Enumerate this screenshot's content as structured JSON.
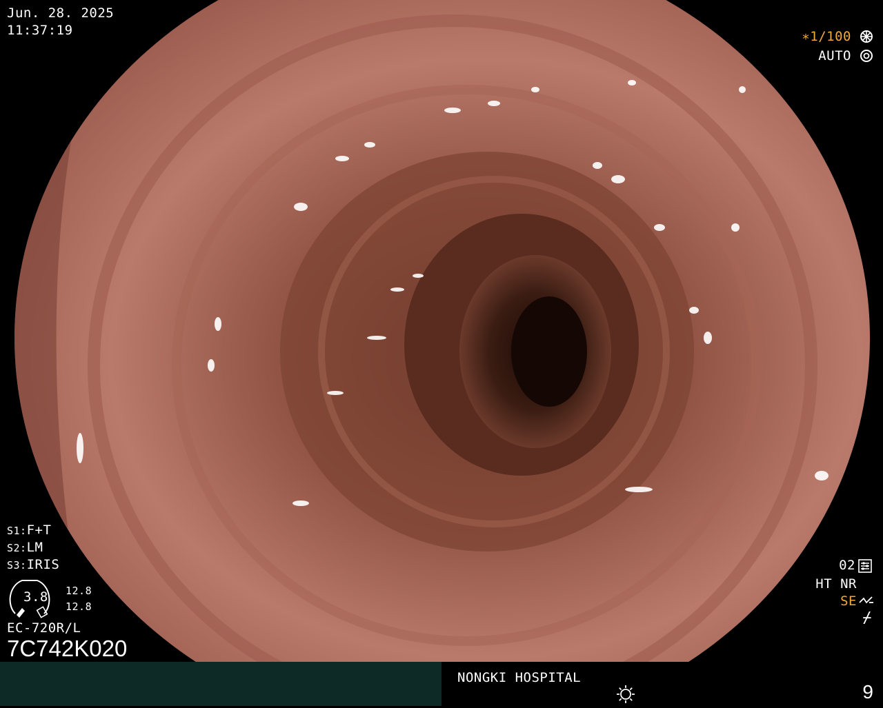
{
  "overlay": {
    "date": "Jun. 28. 2025",
    "time": "11:37:19",
    "shutter": "∗1/100",
    "exposure_mode": "AUTO",
    "settings": [
      {
        "key": "S1:",
        "value": "F+T"
      },
      {
        "key": "S2:",
        "value": "LM"
      },
      {
        "key": "S3:",
        "value": "IRIS"
      }
    ],
    "gauge": {
      "value": "3.8",
      "top": "12.8",
      "bottom": "12.8"
    },
    "scope_model": "EC-720R/L",
    "serial": "7C742K020",
    "right_panel": {
      "preset": "02",
      "modes": "HT NR",
      "se": "SE",
      "flash_symbol": "⌿"
    }
  },
  "footer": {
    "hospital": "NONGKI HOSPITAL",
    "page_number": "9"
  },
  "colors": {
    "accent_orange": "#f2a93b",
    "footer_left": "#0e2a27",
    "mucosa": "#b8756a",
    "lumen": "#2a130d"
  }
}
